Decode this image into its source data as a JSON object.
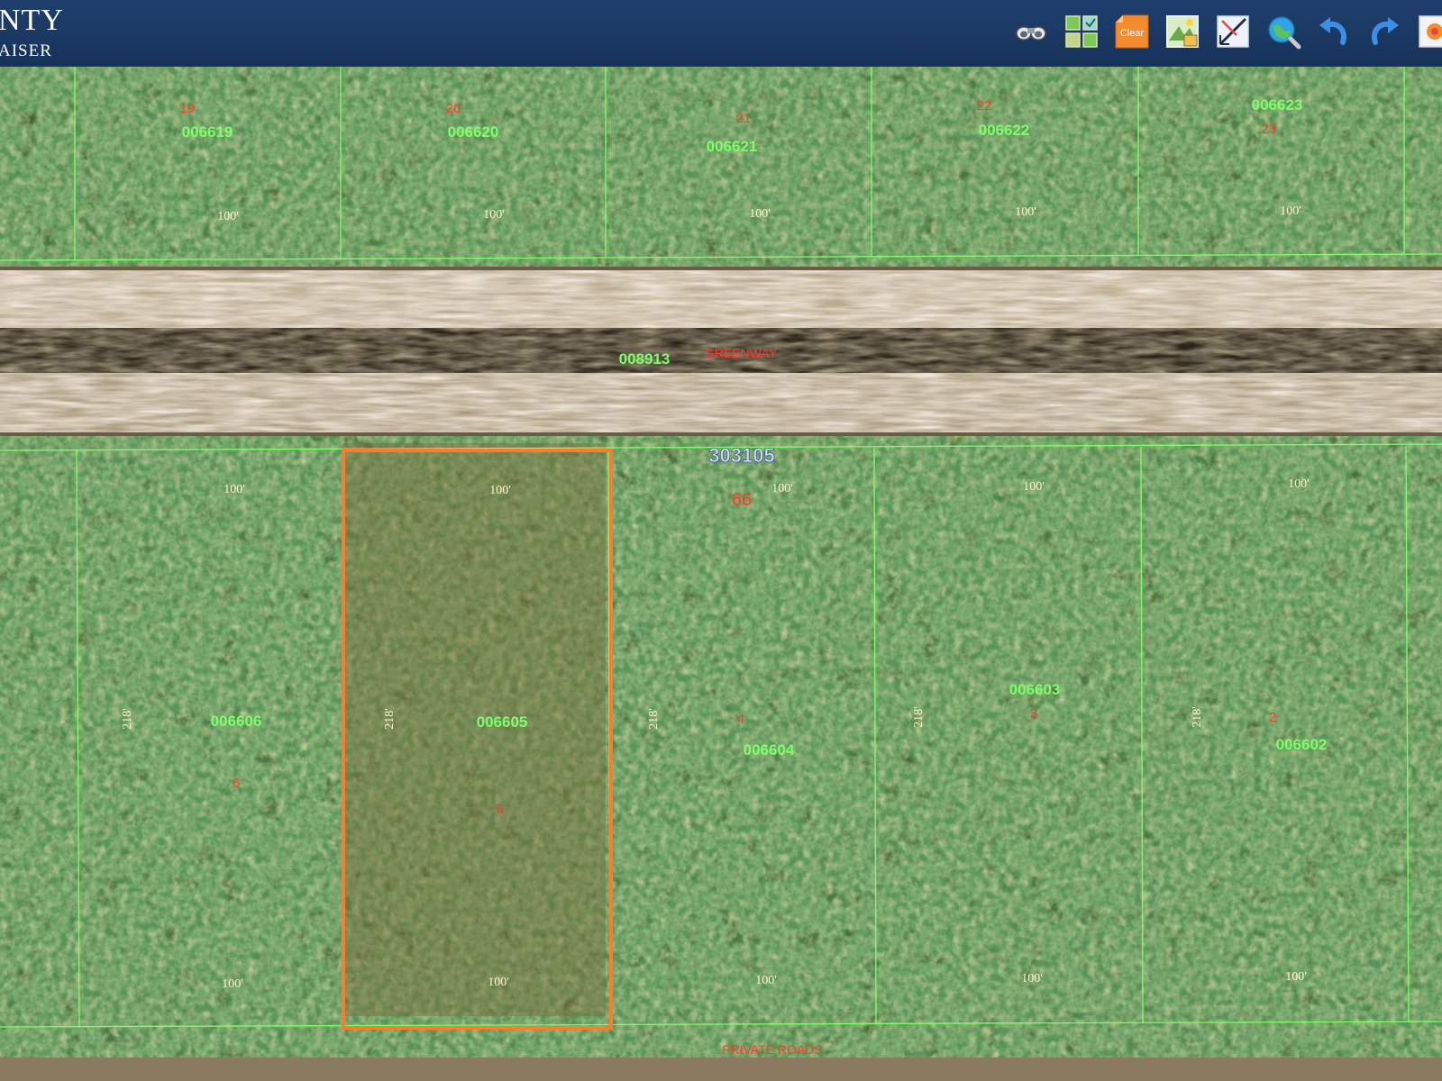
{
  "header": {
    "title_line1": "NTY",
    "title_line2": "AISER"
  },
  "toolbar": {
    "tools": [
      {
        "name": "binoculars-icon"
      },
      {
        "name": "layers-grid-icon"
      },
      {
        "name": "clear-icon",
        "label": "Clear"
      },
      {
        "name": "map-sheet-icon"
      },
      {
        "name": "measure-icon"
      },
      {
        "name": "globe-search-icon"
      },
      {
        "name": "undo-icon"
      },
      {
        "name": "redo-icon"
      },
      {
        "name": "more-icon"
      }
    ]
  },
  "map": {
    "road_north": {
      "id": "008913",
      "name": "GREENWAY"
    },
    "road_south": {
      "name": "PRIVATE ROADS"
    },
    "plat_number": "303105",
    "block_number": "66",
    "north_lots": [
      {
        "lot": "19",
        "id": "006619",
        "frontage": "100'"
      },
      {
        "lot": "20",
        "id": "006620",
        "frontage": "100'"
      },
      {
        "lot": "21",
        "id": "006621",
        "frontage": "100'"
      },
      {
        "lot": "22",
        "id": "006622",
        "frontage": "100'"
      },
      {
        "lot": "23",
        "id": "006623",
        "frontage": "100'"
      }
    ],
    "south_lots": [
      {
        "lot": "6",
        "id": "006606",
        "top": "100'",
        "bottom": "100'",
        "depth": "218'"
      },
      {
        "lot": "5",
        "id": "006605",
        "top": "100'",
        "bottom": "100'",
        "depth": "218'",
        "selected": true
      },
      {
        "lot": "4",
        "id": "006604",
        "top": "100'",
        "bottom": "100'",
        "depth": "218'"
      },
      {
        "lot": "3",
        "id": "006603",
        "top": "100'",
        "bottom": "100'",
        "depth": "218'"
      },
      {
        "lot": "2",
        "id": "006602",
        "top": "100'",
        "bottom": "100'",
        "depth": "218'"
      }
    ],
    "colors": {
      "parcel_line": "#7dff6a",
      "selection": "#ff7a2a",
      "lot_label": "#7dff6a",
      "index_label": "#ff3a2a"
    }
  }
}
